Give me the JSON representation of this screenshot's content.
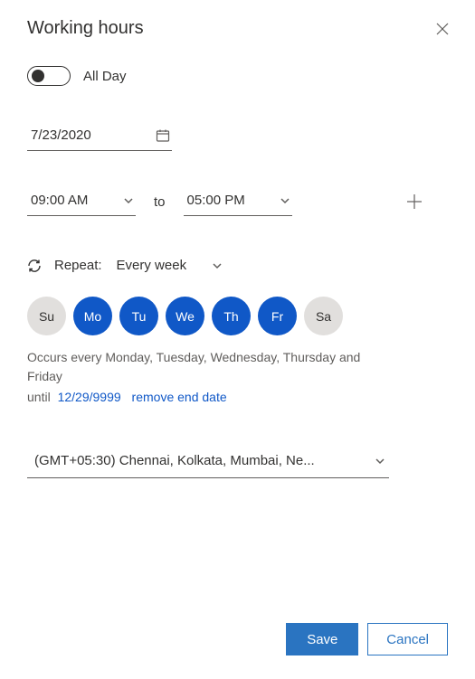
{
  "title": "Working hours",
  "allday": {
    "label": "All Day",
    "on": false
  },
  "date": {
    "value": "7/23/2020"
  },
  "time": {
    "start": "09:00 AM",
    "to_label": "to",
    "end": "05:00 PM"
  },
  "repeat": {
    "label": "Repeat:",
    "value": "Every week",
    "days": [
      {
        "abbr": "Su",
        "selected": false
      },
      {
        "abbr": "Mo",
        "selected": true
      },
      {
        "abbr": "Tu",
        "selected": true
      },
      {
        "abbr": "We",
        "selected": true
      },
      {
        "abbr": "Th",
        "selected": true
      },
      {
        "abbr": "Fr",
        "selected": true
      },
      {
        "abbr": "Sa",
        "selected": false
      }
    ],
    "summary": "Occurs every Monday, Tuesday, Wednesday, Thursday and Friday",
    "until_label": "until",
    "until_date": "12/29/9999",
    "remove_label": "remove end date"
  },
  "timezone": {
    "value": "(GMT+05:30) Chennai, Kolkata, Mumbai, Ne..."
  },
  "footer": {
    "save": "Save",
    "cancel": "Cancel"
  }
}
